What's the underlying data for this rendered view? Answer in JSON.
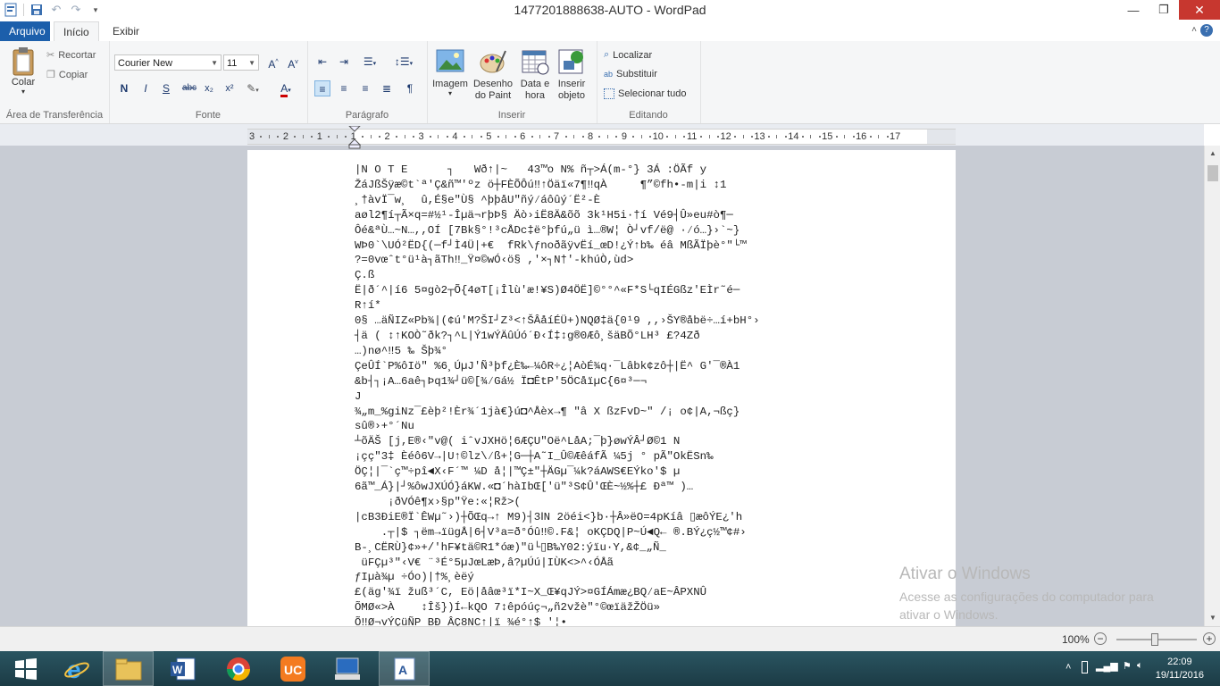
{
  "window": {
    "title": "1477201888638-AUTO - WordPad",
    "minimize": "—",
    "maximize": "❐",
    "close": "✕"
  },
  "tabs": [
    {
      "label": "Arquivo"
    },
    {
      "label": "Início"
    },
    {
      "label": "Exibir"
    }
  ],
  "ribbon": {
    "clipboard": {
      "paste_label": "Colar",
      "cut_label": "Recortar",
      "copy_label": "Copiar",
      "group_label": "Área de Transferência"
    },
    "font": {
      "family": "Courier New",
      "size": "11",
      "group_label": "Fonte",
      "bold": "N",
      "italic": "I",
      "underline": "S",
      "strike": "abc",
      "subscript": "x₂",
      "superscript": "x²"
    },
    "paragraph": {
      "group_label": "Parágrafo"
    },
    "insert": {
      "image_label": "Imagem",
      "paint_label": "Desenho do Paint",
      "datetime_label": "Data e hora",
      "object_label": "Inserir objeto",
      "group_label": "Inserir"
    },
    "editing": {
      "find_label": "Localizar",
      "replace_label": "Substituir",
      "select_all_label": "Selecionar tudo",
      "group_label": "Editando"
    }
  },
  "ruler": {
    "labels": [
      "3",
      "2",
      "1",
      "1",
      "2",
      "3",
      "4",
      "5",
      "6",
      "7",
      "8",
      "9",
      "10",
      "11",
      "12",
      "13",
      "14",
      "15",
      "16",
      "17"
    ]
  },
  "document": {
    "lines": [
      "|N O T E      ┐   Wð↑|~   43™o N% ñ┬>Á(m-°} 3Á :ÖÃf y",
      "ŽáJßŠÿæ©t`ª'Ç&ñ™'ºz ö┼FÈÕÔú‼↑Öäï«7¶‼qÀ     ¶”©fh•-m|i ↕1",
      "¸†àvÏ¯w¸  û,É§e\"Ù§ ^þþåU\"ñý∕áôûý´Ë²-È",
      "aøl2¶í┬Ã×q=#½¹-Îµä¬rþÞ§ Äò›iË8Ä&õõ 3k¹H5i·†í Vé9┤Û»eu#ò¶─",
      "Ôé&ªÙ…~N…,,OÍ [7Bk§°!³cÅDc‡ë°þfú„ü ì…®W¦ Ò┘vf/ë@ ·∕ó…}›`~}",
      "WÞ0`\\UÓ²ËD{(─f┘Ì4Ü|+€  fRk\\ƒnoðãÿvËí_œD!¿Ý↑b‰ éâ MßÃÏþè°\"└™",
      "?=0vœˆt°ü¹à┐ãTh‼_Ÿ¤©wÓ‹ö§ ,'×┐N†'-khúÒ,ùd>",
      "Ç.ß",
      "Ë|ð´^|í6 5¤gò2┬Õ{4øT[¡Îlù'æ!¥S)Ø4ÖË]©°°^«F*S└qIÉGßz'EÌr˜é─",
      "R↑í*",
      "0§ …äÑIZ«Pb¾|(¢ú'M?ŠI┘Z³<↑ŠÂåíÉÜ+)NQØ‡ä{0¹9 ,,›ŠY®åbë÷…í+bH°›",
      "┤ä ( ↕↑KOÒ˜ðk?┐^L|Ý1wÝÄûÚó´Ð‹Í‡↕g®0Æô¸šäBÕ°LH³ £?4Zð",
      "…)nø^‼5 ‰ Šþ¾°",
      "ÇeÛÍ`P%ôIö\" %6¸ÚµJ'Ñ³þf¿È‰←¼ôR÷¿¦AòÉ¾q·¯Lâbk¢zô┼|Ë^ G'¯®À1",
      "&b┤┐¡A…6aê┐Þq1¾┘ü©[¾∕Gá½ Ï◘ÊtP'5ÖCåïµC{6¤³─¬",
      "J",
      "¾„m_%giNz¯£èþ²!Èr¾´1jà€}ú◘^Åèx→¶ \"â X ßzFvD~\" /¡ o¢|A,¬ßç}",
      "sû®›+°´Nu",
      "┴õÄŠ [j,E®‹\"v@( iˆvJXHö¦6ÆÇU\"Oë^LåA;¯þ}øwÝÂ┘Ø©1 N",
      "¡çç\"3‡ Èéô6V→|U↑©lz\\∕ß+¦G─┼A˜I_Û©ÆêáfÃ ¼5j ° pÃ\"OkËSn‰",
      "ÖÇ¦|¯`ç™÷pî◄X‹F´™ ¼D å¦|™Ç±\"┼ÄGµ¯¼k?áAWS€EÝko'$ µ",
      "6ã™_Á}|┘%ôwJXÚÓ}áKW.«◘´hàIbŒ['ü\"³S¢Û'ŒÈ~½%┼£ Ðª™ )…",
      "     ¡ðVÓê¶x›§p\"Ÿe:«¦Rž>(",
      "|cB3ÐiE®Ï`ÊWµ˜›)┼ÕŒq→↑ M9)┤3‖N 2öéi<}b·┼Â»ëO=4pKíâ ▯æôÝE¿'h",
      "    .┬|$ ┐ëm→ïügÅ|6┤V³a=ð°Óû‼©.F&¦ oKÇDQ|P~Ú◄Q← ®.BÝ¿ç½™¢#›",
      "B-¸CËRÙ}¢»+/'hF¥tä©R1*óæ)\"ü└▯B‰Y02:ýïu·Y,&¢_„Ñ_",
      " üFÇµ³\"‹V€ ¨³É°5µJœLæÞ,â?µÚú|IÙK<>^‹ÓÅã",
      "ƒIµà¾µ ÷Óo)|†%¸èëý",
      "£(äg'¾ï žuß³´C, Eö|åâœ³ï*I~X_Œ¥qJÝ>¤GÍÁmæ¿BQ∕aE~ÂPXNÛ",
      "ÕMØ«>À    ↕Îš})Í←kQO 7↕êpóúç¬„ñ2vžè\"°©œïäžŽÖü»",
      "Õ‼Ø¬vÝÇüÑP BÐ ÂÇ8NC↑|ï ¾é°↑$ '¦•"
    ]
  },
  "statusbar": {
    "zoom": "100%",
    "zoom_out": "−",
    "zoom_in": "+",
    "zoom_level": 1.0
  },
  "watermark": {
    "title": "Ativar o Windows",
    "subtitle": "Acesse as configurações do computador para ativar o Windows."
  },
  "taskbar": {
    "time": "22:09",
    "date": "19/11/2016",
    "apps": [
      "start-button",
      "internet-explorer",
      "file-explorer",
      "word",
      "chrome",
      "uc-browser",
      "remote-desktop",
      "wordpad"
    ]
  }
}
